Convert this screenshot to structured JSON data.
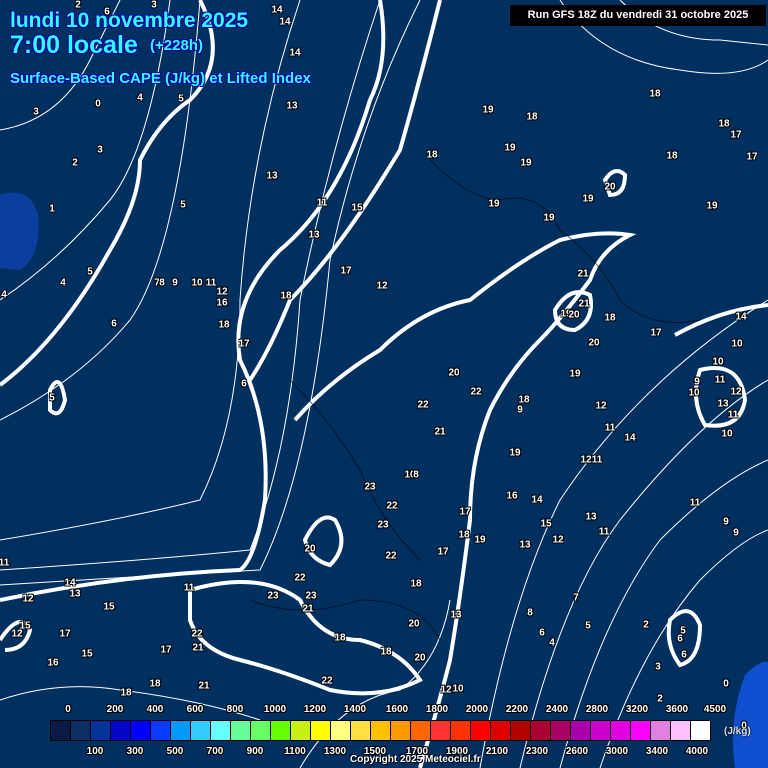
{
  "header": {
    "date": "lundi 10 novembre 2025",
    "time": "7:00 locale",
    "lead": "(+228h)",
    "parameter": "Surface-Based CAPE (J/kg) et Lifted Index",
    "run": "Run GFS 18Z du vendredi 31 octobre 2025"
  },
  "map": {
    "background_color": "#00305f",
    "contour_color": "#ffffff",
    "lifted_index_values": [
      "2",
      "6",
      "3",
      "14",
      "14",
      "14",
      "3",
      "0",
      "4",
      "5",
      "13",
      "3",
      "2",
      "13",
      "5",
      "11",
      "15",
      "13",
      "1",
      "5",
      "4",
      "4",
      "6",
      "7",
      "8",
      "9",
      "10",
      "11",
      "12",
      "16",
      "18",
      "17",
      "12",
      "18",
      "17",
      "6",
      "5",
      "19",
      "18",
      "18",
      "19",
      "19",
      "19",
      "19",
      "20",
      "19",
      "18",
      "18",
      "17",
      "17",
      "18",
      "19",
      "21",
      "21",
      "19",
      "20",
      "18",
      "20",
      "17",
      "14",
      "10",
      "10",
      "9",
      "11",
      "10",
      "12",
      "13",
      "11",
      "10",
      "20",
      "22",
      "22",
      "21",
      "19",
      "12",
      "18",
      "9",
      "11",
      "14",
      "19",
      "11",
      "12",
      "10",
      "8",
      "23",
      "16",
      "14",
      "22",
      "23",
      "17",
      "15",
      "13",
      "11",
      "11",
      "9",
      "9",
      "18",
      "19",
      "12",
      "13",
      "20",
      "22",
      "17",
      "18",
      "22",
      "23",
      "23",
      "21",
      "11",
      "11",
      "14",
      "13",
      "12",
      "15",
      "12",
      "15",
      "17",
      "13",
      "8",
      "7",
      "5",
      "6",
      "4",
      "2",
      "5",
      "6",
      "6",
      "3",
      "22",
      "21",
      "17",
      "18",
      "18",
      "20",
      "20",
      "15",
      "16",
      "22",
      "21",
      "18",
      "18",
      "12",
      "10",
      "2",
      "0",
      "0"
    ]
  },
  "legend": {
    "unit": "(J/kg)",
    "colors": [
      "#0b1a45",
      "#0c2f66",
      "#04349a",
      "#0505c8",
      "#0000ff",
      "#0a3cff",
      "#009aff",
      "#33ccff",
      "#66ffff",
      "#66ff99",
      "#66ff66",
      "#66ff00",
      "#c8f010",
      "#ffff00",
      "#ffff80",
      "#ffe040",
      "#ffc000",
      "#ff9900",
      "#ff6600",
      "#ff3333",
      "#ff3300",
      "#ff0000",
      "#e00000",
      "#b00000",
      "#aa0033",
      "#aa0066",
      "#aa00aa",
      "#cc00cc",
      "#e000e0",
      "#ff00ff",
      "#e080e0",
      "#ffc0ff",
      "#ffffff"
    ],
    "top_labels": [
      "0",
      "200",
      "400",
      "600",
      "800",
      "1000",
      "1200",
      "1400",
      "1600",
      "1800",
      "2000",
      "2200",
      "2400",
      "2800",
      "3200",
      "3600",
      "4500"
    ],
    "bottom_labels": [
      "100",
      "300",
      "500",
      "700",
      "900",
      "1100",
      "1300",
      "1500",
      "1700",
      "1900",
      "2100",
      "2300",
      "2600",
      "3000",
      "3400",
      "4000"
    ]
  },
  "footer": {
    "copyright": "Copyright 2025 Meteociel.fr"
  }
}
